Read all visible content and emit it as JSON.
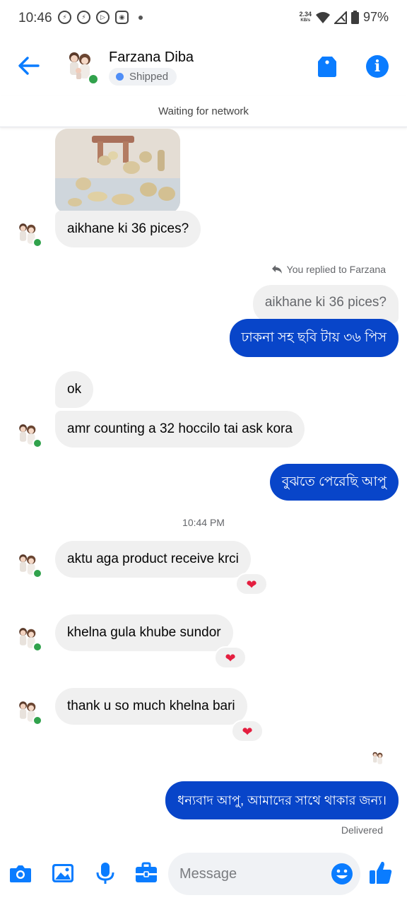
{
  "status_bar": {
    "time": "10:46",
    "net_speed_value": "2.34",
    "net_speed_unit": "KB/s",
    "battery": "97%"
  },
  "header": {
    "contact_name": "Farzana Diba",
    "label": "Shipped",
    "label_color": "#4f8ef7",
    "accent_color": "#0a7cff"
  },
  "network_banner": "Waiting for network",
  "messages": {
    "in_1": "aikhane ki 36 pices?",
    "replied_note": "You replied to Farzana",
    "quoted": "aikhane ki 36 pices?",
    "out_1": "ঢাকনা সহ ছবি টায় ৩৬ পিস",
    "in_2": "ok",
    "in_3": "amr counting a 32 hoccilo tai ask kora",
    "out_2": "বুঝতে পেরেছি আপু",
    "time_divider": "10:44 PM",
    "in_4": "aktu aga product receive krci",
    "in_5": "khelna gula khube sundor",
    "in_6": "thank u so much khelna bari",
    "out_3": "ধন্যবাদ আপু, আমাদের সাথে থাকার জন্য।",
    "reaction": "❤",
    "delivered": "Delivered"
  },
  "composer": {
    "placeholder": "Message",
    "icons": [
      "camera-icon",
      "gallery-icon",
      "microphone-icon",
      "briefcase-icon",
      "emoji-icon",
      "thumbs-up-icon"
    ]
  },
  "colors": {
    "outgoing_bubble": "#0845c9",
    "incoming_bubble": "#f0f0f0",
    "online": "#31a24c",
    "heart": "#e41e3f"
  }
}
